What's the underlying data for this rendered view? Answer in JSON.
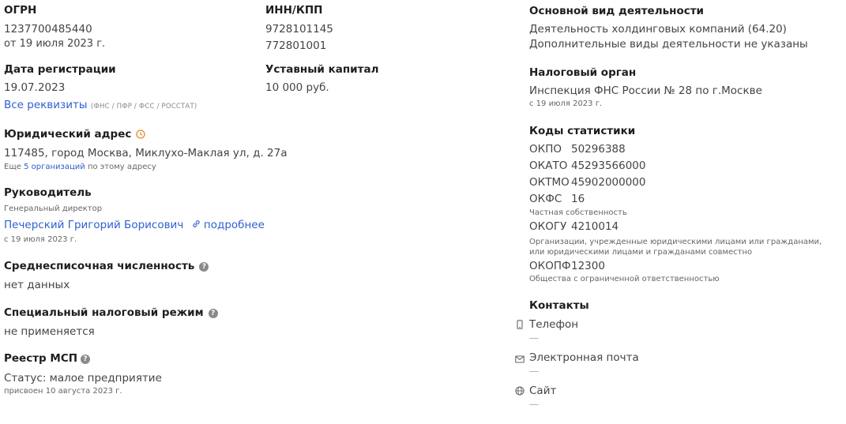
{
  "ogrn": {
    "label": "ОГРН",
    "value": "1237700485440",
    "date": "от 19 июля 2023 г."
  },
  "inn": {
    "label": "ИНН/КПП",
    "inn": "9728101145",
    "kpp": "772801001"
  },
  "registration": {
    "label": "Дата регистрации",
    "value": "19.07.2023",
    "link": "Все реквизиты",
    "link_note": "(ФНС / ПФР / ФСС / РОССТАТ)"
  },
  "capital": {
    "label": "Уставный капитал",
    "value": "10 000 руб."
  },
  "address": {
    "label": "Юридический адрес",
    "value": "117485, город Москва, Миклухо-Маклая ул, д. 27а",
    "more_prefix": "Еще ",
    "more_link": "5 организаций",
    "more_suffix": " по этому адресу"
  },
  "director": {
    "label": "Руководитель",
    "role": "Генеральный директор",
    "name": "Печерский Григорий Борисович",
    "more": "подробнее",
    "date": "с 19 июля 2023 г."
  },
  "headcount": {
    "label": "Среднесписочная численность",
    "value": "нет данных"
  },
  "tax_regime": {
    "label": "Специальный налоговый режим",
    "value": "не применяется"
  },
  "msp": {
    "label": "Реестр МСП",
    "status": "Статус: малое предприятие",
    "date": "присвоен 10 августа 2023 г."
  },
  "activity": {
    "label": "Основной вид деятельности",
    "main": "Деятельность холдинговых компаний (64.20)",
    "extra": "Дополнительные виды деятельности не указаны"
  },
  "tax_office": {
    "label": "Налоговый орган",
    "value": "Инспекция ФНС России № 28 по г.Москве",
    "date": "с 19 июля 2023 г."
  },
  "stats": {
    "label": "Коды статистики",
    "okpo": {
      "name": "ОКПО",
      "value": "50296388"
    },
    "okato": {
      "name": "ОКАТО",
      "value": "45293566000"
    },
    "oktmo": {
      "name": "ОКТМО",
      "value": "45902000000"
    },
    "okfs": {
      "name": "ОКФС",
      "value": "16",
      "desc": "Частная собственность"
    },
    "okogu": {
      "name": "ОКОГУ",
      "value": "4210014",
      "desc": "Организации, учрежденные юридическими лицами или гражданами, или юридическими лицами и гражданами совместно"
    },
    "okopf": {
      "name": "ОКОПФ",
      "value": "12300",
      "desc": "Общества с ограниченной ответственностью"
    }
  },
  "contacts": {
    "label": "Контакты",
    "phone": {
      "label": "Телефон",
      "value": "—"
    },
    "email": {
      "label": "Электронная почта",
      "value": "—"
    },
    "site": {
      "label": "Сайт",
      "value": "—"
    }
  },
  "icons": {
    "help": "question-icon",
    "clock": "clock-icon",
    "link": "chain-link-icon",
    "phone": "phone-icon",
    "email": "mail-icon",
    "site": "globe-icon"
  },
  "colors": {
    "link": "#2f5fd0",
    "clock": "#e08a2e",
    "help": "#8a8a8a"
  }
}
